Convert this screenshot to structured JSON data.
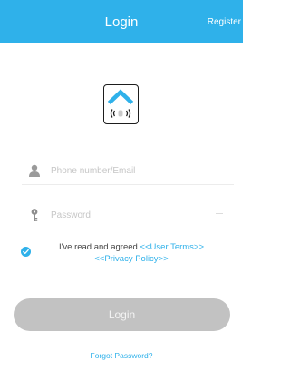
{
  "header": {
    "title": "Login",
    "register_label": "Register",
    "background": "#2fb1ea"
  },
  "logo": {
    "icon": "house-wifi-logo-icon",
    "accent": "#2fb1ea"
  },
  "form": {
    "user_placeholder": "Phone number/Email",
    "user_icon": "user-icon",
    "password_placeholder": "Password",
    "password_icon": "key-icon"
  },
  "agreement": {
    "checked": true,
    "text": "I've read and agreed ",
    "user_terms": "<<User Terms>>",
    "privacy_policy": "<<Privacy Policy>>"
  },
  "login_button": {
    "label": "Login",
    "color": "#c2c2c2"
  },
  "forgot_password": "Forgot Password?"
}
